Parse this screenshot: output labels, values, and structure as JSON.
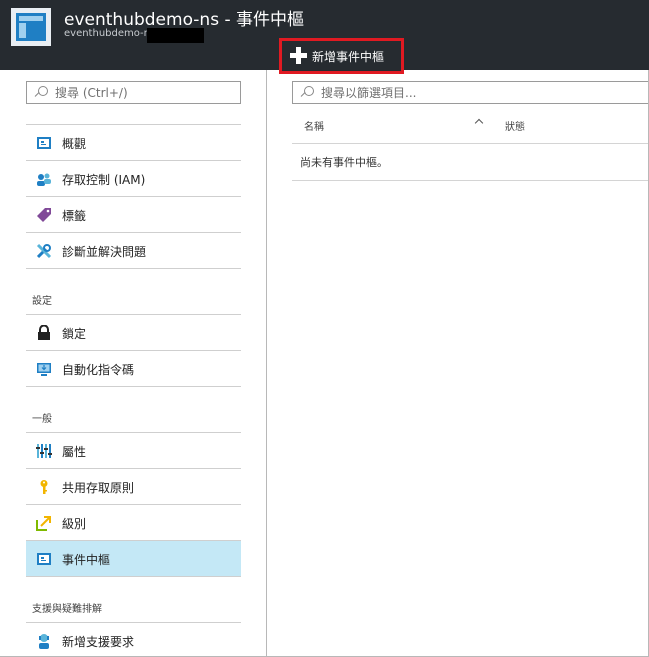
{
  "header": {
    "title": "eventhubdemo-ns - 事件中樞",
    "subtitle": "eventhubdemo-ns"
  },
  "toolbar": {
    "add_label": "新增事件中樞"
  },
  "sidebar": {
    "search_placeholder": "搜尋 (Ctrl+/)",
    "items": [
      {
        "label": "概觀",
        "icon": "overview-icon"
      },
      {
        "label": "存取控制 (IAM)",
        "icon": "access-control-icon"
      },
      {
        "label": "標籤",
        "icon": "tag-icon"
      },
      {
        "label": "診斷並解決問題",
        "icon": "wrench-icon"
      }
    ],
    "section_settings": "設定",
    "settings_items": [
      {
        "label": "鎖定",
        "icon": "lock-icon"
      },
      {
        "label": "自動化指令碼",
        "icon": "automation-script-icon"
      }
    ],
    "section_general": "一般",
    "general_items": [
      {
        "label": "屬性",
        "icon": "properties-icon"
      },
      {
        "label": "共用存取原則",
        "icon": "key-icon"
      },
      {
        "label": "級別",
        "icon": "scale-icon"
      },
      {
        "label": "事件中樞",
        "icon": "event-hub-icon",
        "active": true
      }
    ],
    "section_support": "支援與疑難排解",
    "support_items": [
      {
        "label": "新增支援要求",
        "icon": "support-request-icon"
      }
    ]
  },
  "main": {
    "filter_placeholder": "搜尋以篩選項目...",
    "columns": [
      "名稱",
      "狀態"
    ],
    "empty_message": "尚未有事件中樞。"
  },
  "colors": {
    "header_bg": "#262b30",
    "highlight_red": "#e01a22",
    "active_item_bg": "#c4e8f6",
    "accent_blue": "#1f7fc4"
  }
}
